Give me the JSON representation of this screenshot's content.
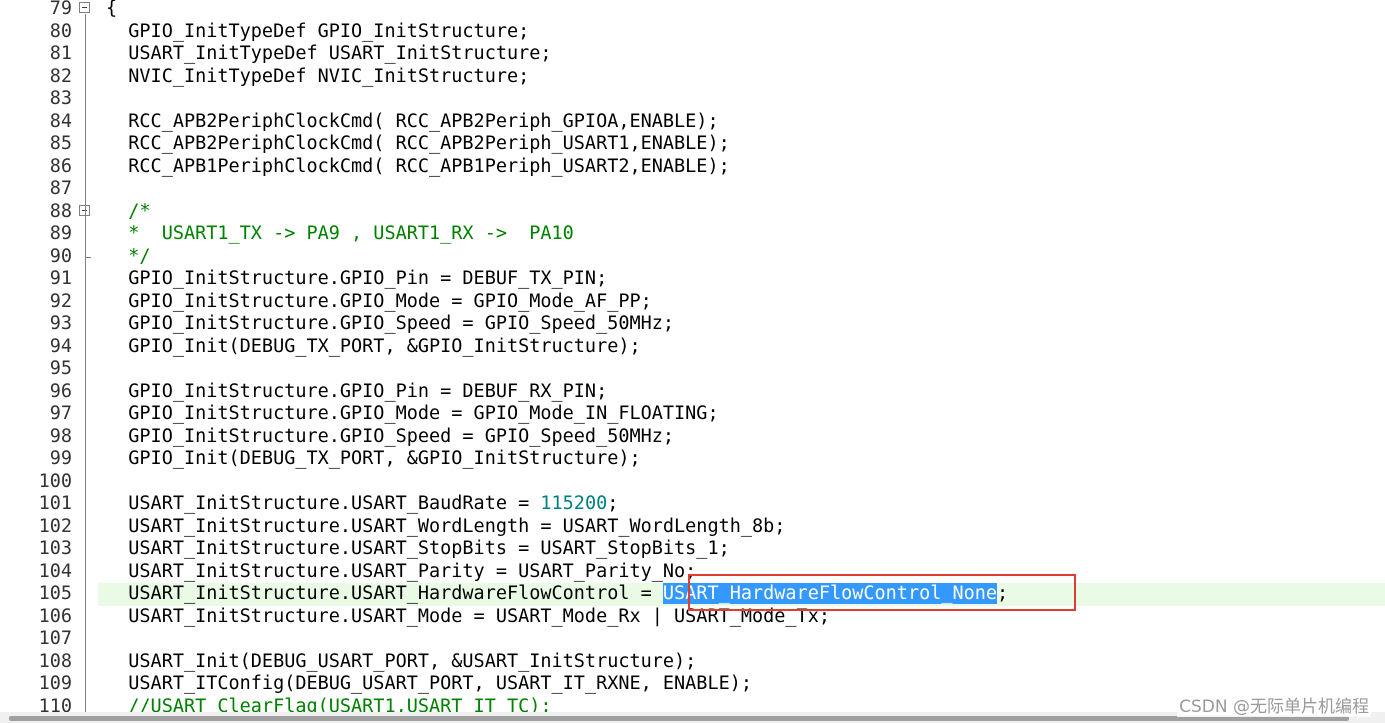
{
  "editor": {
    "current_line": "105",
    "lines": [
      {
        "num": "79",
        "segments": [
          {
            "t": "{"
          }
        ],
        "fold": "open"
      },
      {
        "num": "80",
        "segments": [
          {
            "t": "  GPIO_InitTypeDef GPIO_InitStructure;"
          }
        ]
      },
      {
        "num": "81",
        "segments": [
          {
            "t": "  USART_InitTypeDef USART_InitStructure;"
          }
        ]
      },
      {
        "num": "82",
        "segments": [
          {
            "t": "  NVIC_InitTypeDef NVIC_InitStructure;"
          }
        ]
      },
      {
        "num": "83",
        "segments": [
          {
            "t": ""
          }
        ]
      },
      {
        "num": "84",
        "segments": [
          {
            "t": "  RCC_APB2PeriphClockCmd( RCC_APB2Periph_GPIOA,ENABLE);"
          }
        ]
      },
      {
        "num": "85",
        "segments": [
          {
            "t": "  RCC_APB2PeriphClockCmd( RCC_APB2Periph_USART1,ENABLE);"
          }
        ]
      },
      {
        "num": "86",
        "segments": [
          {
            "t": "  RCC_APB1PeriphClockCmd( RCC_APB1Periph_USART2,ENABLE);"
          }
        ]
      },
      {
        "num": "87",
        "segments": [
          {
            "t": ""
          }
        ]
      },
      {
        "num": "88",
        "segments": [
          {
            "t": "  /*",
            "k": "c"
          }
        ],
        "fold": "open"
      },
      {
        "num": "89",
        "segments": [
          {
            "t": "  *  USART1_TX -> PA9 , USART1_RX ->  PA10",
            "k": "c"
          }
        ]
      },
      {
        "num": "90",
        "segments": [
          {
            "t": "  */",
            "k": "c"
          }
        ],
        "fold": "end"
      },
      {
        "num": "91",
        "segments": [
          {
            "t": "  GPIO_InitStructure.GPIO_Pin = DEBUF_TX_PIN;"
          }
        ]
      },
      {
        "num": "92",
        "segments": [
          {
            "t": "  GPIO_InitStructure.GPIO_Mode = GPIO_Mode_AF_PP;"
          }
        ]
      },
      {
        "num": "93",
        "segments": [
          {
            "t": "  GPIO_InitStructure.GPIO_Speed = GPIO_Speed_50MHz;"
          }
        ]
      },
      {
        "num": "94",
        "segments": [
          {
            "t": "  GPIO_Init(DEBUG_TX_PORT, &GPIO_InitStructure);"
          }
        ]
      },
      {
        "num": "95",
        "segments": [
          {
            "t": ""
          }
        ]
      },
      {
        "num": "96",
        "segments": [
          {
            "t": "  GPIO_InitStructure.GPIO_Pin = DEBUF_RX_PIN;"
          }
        ]
      },
      {
        "num": "97",
        "segments": [
          {
            "t": "  GPIO_InitStructure.GPIO_Mode = GPIO_Mode_IN_FLOATING;"
          }
        ]
      },
      {
        "num": "98",
        "segments": [
          {
            "t": "  GPIO_InitStructure.GPIO_Speed = GPIO_Speed_50MHz;"
          }
        ]
      },
      {
        "num": "99",
        "segments": [
          {
            "t": "  GPIO_Init(DEBUG_TX_PORT, &GPIO_InitStructure);"
          }
        ]
      },
      {
        "num": "100",
        "segments": [
          {
            "t": ""
          }
        ]
      },
      {
        "num": "101",
        "segments": [
          {
            "t": "  USART_InitStructure.USART_BaudRate = "
          },
          {
            "t": "115200",
            "k": "n"
          },
          {
            "t": ";"
          }
        ]
      },
      {
        "num": "102",
        "segments": [
          {
            "t": "  USART_InitStructure.USART_WordLength = USART_WordLength_8b;"
          }
        ]
      },
      {
        "num": "103",
        "segments": [
          {
            "t": "  USART_InitStructure.USART_StopBits = USART_StopBits_1;"
          }
        ]
      },
      {
        "num": "104",
        "segments": [
          {
            "t": "  USART_InitStructure.USART_Parity = USART_Parity_No;"
          }
        ]
      },
      {
        "num": "105",
        "segments": [
          {
            "t": "  USART_InitStructure.USART_HardwareFlowControl = "
          },
          {
            "t": "USART_HardwareFlowControl_None",
            "k": "sel"
          },
          {
            "t": ";"
          }
        ]
      },
      {
        "num": "106",
        "segments": [
          {
            "t": "  USART_InitStructure.USART_Mode = USART_Mode_Rx | USART_Mode_Tx;"
          }
        ]
      },
      {
        "num": "107",
        "segments": [
          {
            "t": ""
          }
        ]
      },
      {
        "num": "108",
        "segments": [
          {
            "t": "  USART_Init(DEBUG_USART_PORT, &USART_InitStructure);"
          }
        ]
      },
      {
        "num": "109",
        "segments": [
          {
            "t": "  USART_ITConfig(DEBUG_USART_PORT, USART_IT_RXNE, ENABLE);"
          }
        ]
      },
      {
        "num": "110",
        "segments": [
          {
            "t": "  //USART_ClearFlag(USART1,USART_IT_TC);",
            "k": "c"
          }
        ]
      }
    ]
  },
  "watermark": "CSDN @无际单片机编程",
  "colors": {
    "comment": "#008000",
    "number": "#008080",
    "selection": "#3399ff",
    "current_line": "#e9fbe5",
    "highlight_box": "#e03c31"
  }
}
